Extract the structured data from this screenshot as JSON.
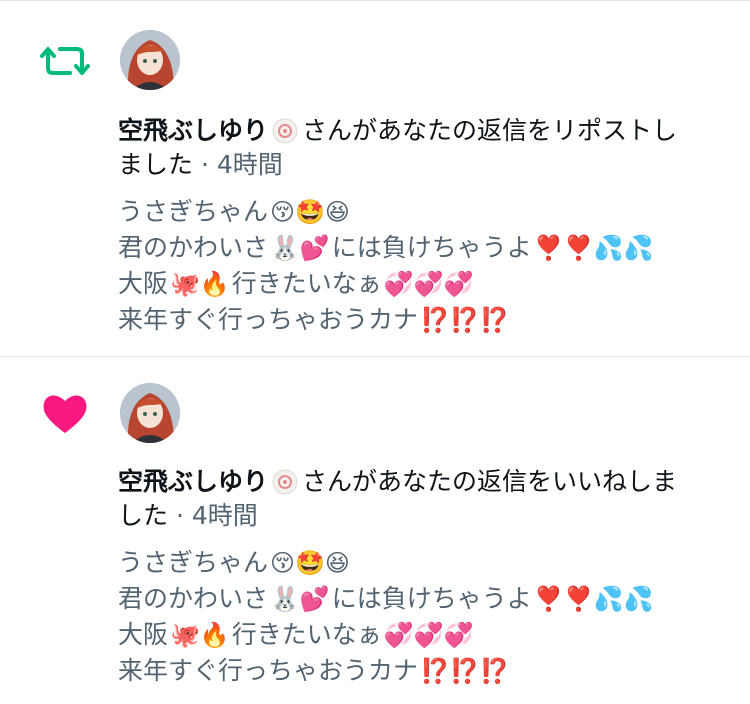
{
  "notifications": [
    {
      "type": "repost",
      "type_icon": "repost-icon",
      "user_name": "空飛ぶしゆり",
      "action_text": "さんがあなたの返信をリポストし",
      "action_text_2": "ました",
      "separator": "·",
      "time": "4時間",
      "post_lines": [
        {
          "text": "うさぎちゃん",
          "emoji": "😚🤩😆"
        },
        {
          "text": "君のかわいさ",
          "emoji": "🐰💕",
          "text2": "には負けちゃうよ",
          "emoji2": "❣️❣️💦💦"
        },
        {
          "text": "大阪",
          "emoji": "🐙🔥",
          "text2": "行きたいなぁ",
          "emoji2": "💞💞💞"
        },
        {
          "text": "来年すぐ行っちゃおうカナ",
          "emoji": "⁉️⁉️⁉️"
        }
      ]
    },
    {
      "type": "like",
      "type_icon": "heart-icon",
      "user_name": "空飛ぶしゆり",
      "action_text": "さんがあなたの返信をいいねしま",
      "action_text_2": "した",
      "separator": "·",
      "time": "4時間",
      "post_lines": [
        {
          "text": "うさぎちゃん",
          "emoji": "😚🤩😆"
        },
        {
          "text": "君のかわいさ",
          "emoji": "🐰💕",
          "text2": "には負けちゃうよ",
          "emoji2": "❣️❣️💦💦"
        },
        {
          "text": "大阪",
          "emoji": "🐙🔥",
          "text2": "行きたいなぁ",
          "emoji2": "💞💞💞"
        },
        {
          "text": "来年すぐ行っちゃおうカナ",
          "emoji": "⁉️⁉️⁉️"
        }
      ]
    }
  ],
  "colors": {
    "repost": "#00ba7c",
    "like": "#f91880",
    "secondary_text": "#536471",
    "divider": "#e6e7e8"
  }
}
